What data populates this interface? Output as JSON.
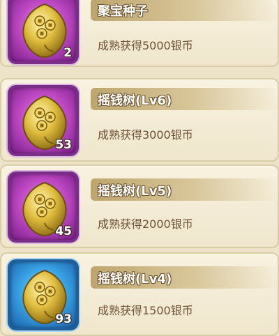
{
  "items": [
    {
      "name": "聚宝种子",
      "desc": "成熟获得5000银币",
      "count": "2",
      "frame": "purple",
      "seed_icon": "treasure-seed-icon"
    },
    {
      "name": "摇钱树(Lv6)",
      "desc": "成熟获得3000银币",
      "count": "53",
      "frame": "purple",
      "seed_icon": "money-tree-seed-icon"
    },
    {
      "name": "摇钱树(Lv5)",
      "desc": "成熟获得2000银币",
      "count": "45",
      "frame": "purple",
      "seed_icon": "money-tree-seed-icon"
    },
    {
      "name": "摇钱树(Lv4)",
      "desc": "成熟获得1500银币",
      "count": "93",
      "frame": "blue",
      "seed_icon": "money-tree-seed-icon"
    }
  ],
  "colors": {
    "purple_frame": "#7b2d8a",
    "blue_frame": "#1f5f9a",
    "coin_gold": "#d9b23a",
    "text_brown": "#6e5236"
  }
}
